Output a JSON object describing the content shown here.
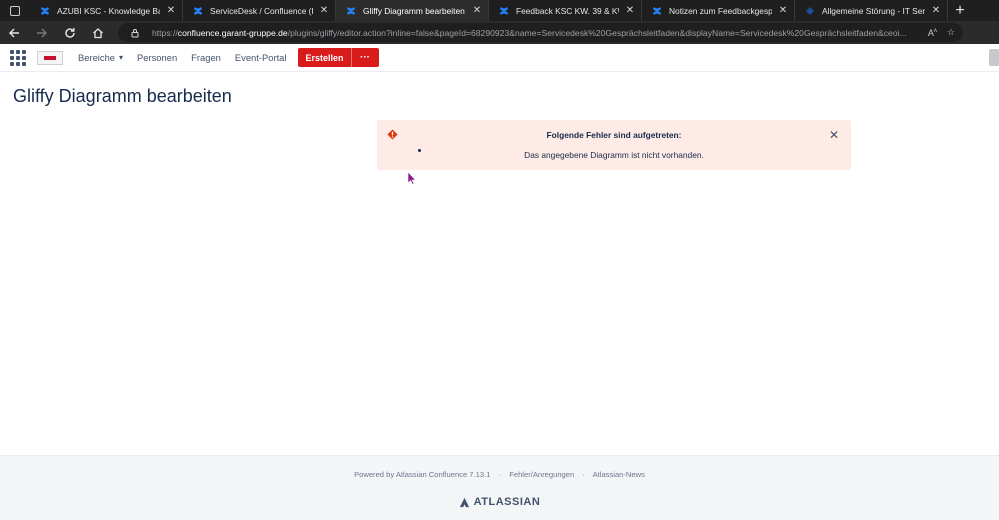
{
  "browser": {
    "tabs": [
      {
        "title": "AZUBI KSC - Knowledge Base - C",
        "active": false
      },
      {
        "title": "ServiceDesk / Confluence (KSC)",
        "active": false
      },
      {
        "title": "Gliffy Diagramm bearbeiten - Ga",
        "active": true
      },
      {
        "title": "Feedback KSC KW. 39 & KW. 41",
        "active": false
      },
      {
        "title": "Notizen zum Feedbackgespräch",
        "active": false
      },
      {
        "title": "Allgemeine Störung - IT Servicec",
        "active": false
      }
    ],
    "url_prefix": "https://",
    "url_host": "confluence.garant-gruppe.de",
    "url_path": "/plugins/gliffy/editor.action?inline=false&pageId=68290923&name=Servicedesk%20Gesprächsleitfaden&displayName=Servicedesk%20Gesprächsleitfaden&ceoi..."
  },
  "header": {
    "nav": {
      "bereiche": "Bereiche",
      "personen": "Personen",
      "fragen": "Fragen",
      "event_portal": "Event-Portal"
    },
    "create_label": "Erstellen",
    "more_label": "···"
  },
  "page": {
    "title": "Gliffy Diagramm bearbeiten"
  },
  "error": {
    "title": "Folgende Fehler sind aufgetreten:",
    "message": "Das angegebene Diagramm ist nicht vorhanden."
  },
  "footer": {
    "powered": "Powered by Atlassian Confluence 7.13.1",
    "feedback": "Fehler/Anregungen",
    "news": "Atlassian-News",
    "brand": "ATLASSIAN"
  },
  "colors": {
    "create_button": "#d81b1b",
    "error_bg": "#ffebe6",
    "error_icon": "#de350b",
    "tab_favicon": "#2684ff"
  }
}
